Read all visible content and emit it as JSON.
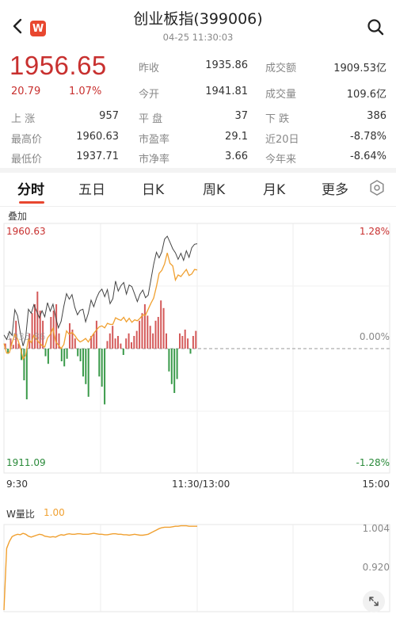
{
  "header": {
    "title": "创业板指(399006)",
    "timestamp": "04-25 11:30:03",
    "logo_text": "W"
  },
  "quote": {
    "price": "1956.65",
    "change": "20.79",
    "change_pct": "1.07%",
    "accent_up": "#c8302f",
    "accent_down": "#2a8a3a"
  },
  "stats_right": [
    {
      "l1": "昨收",
      "v1": "1935.86",
      "l2": "成交额",
      "v2": "1909.53亿"
    },
    {
      "l1": "今开",
      "v1": "1941.81",
      "l2": "成交量",
      "v2": "109.6亿"
    }
  ],
  "stats_grid": [
    {
      "l1": "上  涨",
      "v1": "957",
      "l2": "平  盘",
      "v2": "37",
      "l3": "下  跌",
      "v3": "386"
    },
    {
      "l1": "最高价",
      "v1": "1960.63",
      "l2": "市盈率",
      "v2": "29.1",
      "l3": "近20日",
      "v3": "-8.78%"
    },
    {
      "l1": "最低价",
      "v1": "1937.71",
      "l2": "市净率",
      "v2": "3.66",
      "l3": "今年来",
      "v3": "-8.64%"
    }
  ],
  "tabs": [
    "分时",
    "五日",
    "日K",
    "周K",
    "月K",
    "更多"
  ],
  "active_tab": "分时",
  "overlay_label": "叠加",
  "intraday": {
    "high_label": "1960.63",
    "low_label": "1911.09",
    "high_pct": "1.28%",
    "zero_pct": "0.00%",
    "low_pct": "-1.28%",
    "ref_label": "1935.86",
    "time_start": "9:30",
    "time_mid": "11:30/13:00",
    "time_end": "15:00"
  },
  "wratio": {
    "label": "W量比",
    "value": "1.00",
    "tick_high": "1.004",
    "tick_low": "0.920"
  },
  "chart_data": {
    "type": "line",
    "title": "",
    "xlabel": "",
    "ylabel": "",
    "ylim": [
      1911.09,
      1960.63
    ],
    "x_ticks": [
      "9:30",
      "11:30/13:00",
      "15:00"
    ],
    "series": [
      {
        "values": [
          1938.5,
          1937.6,
          1939.2,
          1938.4,
          1943.5,
          1942.3,
          1939.0,
          1936.3,
          1938.1,
          1943.6,
          1942.8,
          1944.5,
          1943.2,
          1941.9,
          1943.3,
          1942.1,
          1944.9,
          1943.2,
          1944.6,
          1942.0,
          1939.9,
          1941.2,
          1944.2,
          1946.7,
          1945.6,
          1946.5,
          1944.0,
          1942.5,
          1943.4,
          1943.6,
          1941.1,
          1942.8,
          1945.4,
          1944.1,
          1945.8,
          1947.0,
          1947.6,
          1946.1,
          1947.5,
          1944.7,
          1945.7,
          1949.2,
          1947.2,
          1948.3,
          1948.9,
          1946.6,
          1948.4,
          1948.1,
          1946.6,
          1945.1,
          1946.6,
          1947.4,
          1945.9,
          1946.4,
          1949.5,
          1952.5,
          1954.9,
          1953.8,
          1955.0,
          1957.5,
          1958.1,
          1956.9,
          1955.6,
          1954.8,
          1953.5,
          1954.7,
          1953.3,
          1955.2,
          1953.9,
          1955.8,
          1956.5,
          1956.6
        ]
      },
      {
        "values": [
          1936.8,
          1934.9,
          1935.0,
          1937.0,
          1938.6,
          1937.7,
          1936.1,
          1933.7,
          1934.5,
          1937.7,
          1937.0,
          1938.4,
          1937.6,
          1936.9,
          1936.4,
          1936.1,
          1937.9,
          1938.6,
          1939.8,
          1937.2,
          1936.5,
          1935.8,
          1936.6,
          1939.3,
          1938.6,
          1939.0,
          1938.4,
          1937.6,
          1937.1,
          1937.4,
          1937.8,
          1937.1,
          1938.0,
          1938.8,
          1939.5,
          1940.1,
          1940.3,
          1939.9,
          1940.8,
          1940.6,
          1940.6,
          1941.9,
          1941.6,
          1941.4,
          1942.0,
          1941.1,
          1941.8,
          1941.0,
          1941.5,
          1941.3,
          1941.8,
          1942.5,
          1942.4,
          1943.6,
          1944.8,
          1945.8,
          1948.1,
          1950.7,
          1951.3,
          1952.6,
          1954.8,
          1952.7,
          1952.2,
          1949.4,
          1950.4,
          1950.1,
          1950.8,
          1951.5,
          1950.3,
          1950.6,
          1951.5,
          1951.4
        ]
      }
    ],
    "volume_bars": [
      4,
      -4,
      8,
      3,
      22,
      4,
      -9,
      -25,
      -40,
      12,
      28,
      35,
      45,
      30,
      22,
      -6,
      -12,
      25,
      30,
      35,
      12,
      -10,
      -14,
      -8,
      20,
      15,
      8,
      -6,
      -10,
      -22,
      -28,
      -38,
      10,
      12,
      22,
      -22,
      -30,
      -44,
      6,
      12,
      18,
      8,
      10,
      4,
      -5,
      8,
      12,
      5,
      10,
      14,
      22,
      28,
      35,
      26,
      18,
      12,
      22,
      25,
      38,
      32,
      12,
      -18,
      -28,
      -35,
      -24,
      12,
      10,
      15,
      8,
      -4,
      10,
      14
    ],
    "wratio": {
      "ylim": [
        0.92,
        1.004
      ],
      "values": [
        0.82,
        0.96,
        0.975,
        0.985,
        0.988,
        0.99,
        0.989,
        0.992,
        0.99,
        0.986,
        0.984,
        0.986,
        0.988,
        0.99,
        0.989,
        0.986,
        0.985,
        0.984,
        0.985,
        0.984,
        0.987,
        0.989,
        0.988,
        0.99,
        0.991,
        0.99,
        0.99,
        0.991,
        0.991,
        0.99,
        0.99,
        0.99,
        0.991,
        0.992,
        0.991,
        0.99,
        0.99,
        0.989,
        0.989,
        0.99,
        0.991,
        0.991,
        0.99,
        0.99,
        0.989,
        0.989,
        0.988,
        0.989,
        0.99,
        0.989,
        0.988,
        0.988,
        0.989,
        0.99,
        0.993,
        0.996,
        0.999,
        1.002,
        1.004,
        1.005,
        1.005,
        1.005,
        1.006,
        1.007,
        1.007,
        1.008,
        1.008,
        1.008,
        1.007,
        1.007,
        1.007,
        1.007
      ]
    }
  }
}
